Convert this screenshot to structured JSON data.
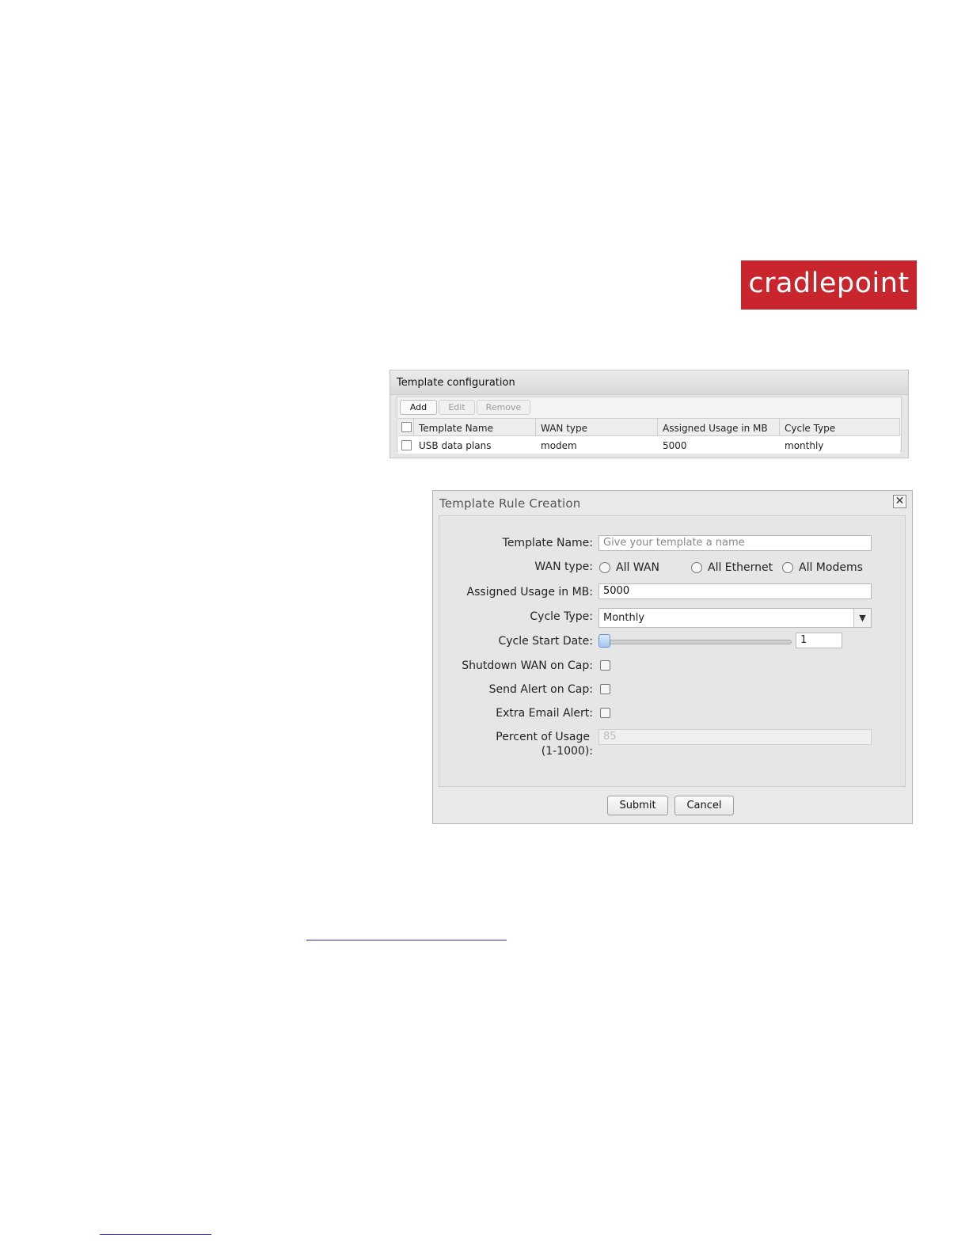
{
  "logo": {
    "text": "cradlepoint",
    "color": "#c8262c"
  },
  "template_config": {
    "title": "Template configuration",
    "toolbar": {
      "add": "Add",
      "edit": "Edit",
      "remove": "Remove"
    },
    "columns": [
      "Template Name",
      "WAN type",
      "Assigned Usage in MB",
      "Cycle Type"
    ],
    "rows": [
      {
        "name": "USB data plans",
        "wan_type": "modem",
        "usage": "5000",
        "cycle": "monthly",
        "checked": false
      }
    ]
  },
  "dialog": {
    "title": "Template Rule Creation",
    "close_icon": "close-icon",
    "fields": {
      "template_name": {
        "label": "Template Name:",
        "placeholder": "Give your template a name",
        "value": ""
      },
      "wan_type": {
        "label": "WAN type:",
        "options": [
          "All WAN",
          "All Ethernet",
          "All Modems"
        ],
        "selected": null
      },
      "assigned_usage": {
        "label": "Assigned Usage in MB:",
        "value": "5000"
      },
      "cycle_type": {
        "label": "Cycle Type:",
        "value": "Monthly"
      },
      "cycle_start_date": {
        "label": "Cycle Start Date:",
        "value": "1",
        "slider_level": 0
      },
      "shutdown_wan": {
        "label": "Shutdown WAN on Cap:",
        "checked": false
      },
      "send_alert": {
        "label": "Send Alert on Cap:",
        "checked": false
      },
      "extra_email": {
        "label": "Extra Email Alert:",
        "checked": false
      },
      "percent_usage": {
        "label_line1": "Percent of Usage",
        "label_line2": "(1-1000):",
        "value": "85",
        "disabled": true
      }
    },
    "buttons": {
      "submit": "Submit",
      "cancel": "Cancel"
    }
  }
}
